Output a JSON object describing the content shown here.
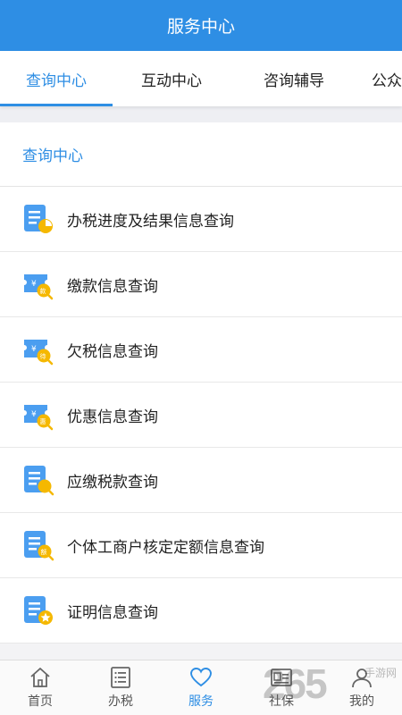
{
  "header": {
    "title": "服务中心"
  },
  "tabs": [
    {
      "label": "查询中心",
      "active": true
    },
    {
      "label": "互动中心"
    },
    {
      "label": "咨询辅导"
    },
    {
      "label": "公众"
    }
  ],
  "section": {
    "title": "查询中心"
  },
  "items": [
    {
      "label": "办税进度及结果信息查询",
      "icon": "progress-doc-icon"
    },
    {
      "label": "缴款信息查询",
      "icon": "ticket-pay-icon"
    },
    {
      "label": "欠税信息查询",
      "icon": "ticket-owe-icon"
    },
    {
      "label": "优惠信息查询",
      "icon": "ticket-discount-icon"
    },
    {
      "label": "应缴税款查询",
      "icon": "doc-search-icon"
    },
    {
      "label": "个体工商户核定定额信息查询",
      "icon": "doc-quota-icon"
    },
    {
      "label": "证明信息查询",
      "icon": "doc-certificate-icon"
    }
  ],
  "nav": [
    {
      "label": "首页",
      "icon": "home-icon"
    },
    {
      "label": "办税",
      "icon": "list-icon"
    },
    {
      "label": "服务",
      "icon": "heart-icon",
      "active": true
    },
    {
      "label": "社保",
      "icon": "id-card-icon"
    },
    {
      "label": "我的",
      "icon": "user-icon"
    }
  ],
  "watermark": {
    "number": "265",
    "text": "手游网"
  },
  "colors": {
    "primary": "#2e8ee4",
    "accent_yellow": "#f5b800"
  }
}
